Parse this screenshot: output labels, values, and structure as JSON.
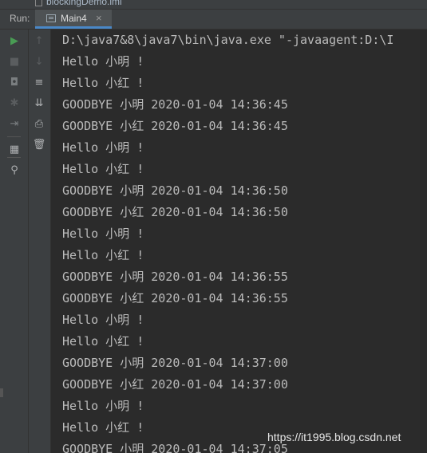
{
  "top_file": {
    "name": "blockingDemo.iml"
  },
  "run_panel": {
    "label": "Run:",
    "tab_label": "Main4",
    "tab_close": "×"
  },
  "toolbar_left": [
    {
      "icon": "run-icon",
      "glyph": "▶",
      "color": "#499c54"
    },
    {
      "icon": "stop-icon",
      "glyph": "■",
      "color": "#5a5d5f"
    },
    {
      "icon": "camera-icon",
      "glyph": "◘",
      "color": "#7a7e80"
    },
    {
      "icon": "bug-icon",
      "glyph": "✱",
      "color": "#5a5d5f"
    },
    {
      "icon": "login-icon",
      "glyph": "⇥",
      "color": "#7a7e80"
    },
    {
      "icon": "layout-icon",
      "glyph": "▦",
      "color": "#afb1b3"
    },
    {
      "icon": "pin-icon",
      "glyph": "⚲",
      "color": "#afb1b3"
    }
  ],
  "toolbar_right": [
    {
      "icon": "arrow-up-icon",
      "glyph": "↑",
      "color": "#5a5d5f"
    },
    {
      "icon": "arrow-down-icon",
      "glyph": "↓",
      "color": "#5a5d5f"
    },
    {
      "icon": "soft-wrap-icon",
      "glyph": "≡",
      "color": "#afb1b3"
    },
    {
      "icon": "scroll-to-end-icon",
      "glyph": "⇊",
      "color": "#afb1b3"
    },
    {
      "icon": "print-icon",
      "glyph": "⎙",
      "color": "#afb1b3"
    },
    {
      "icon": "trash-icon",
      "glyph": "🗑",
      "color": "#afb1b3"
    }
  ],
  "console_lines": [
    "D:\\java7&8\\java7\\bin\\java.exe \"-javaagent:D:\\I",
    "Hello 小明 !",
    "Hello 小红 !",
    "GOODBYE 小明 2020-01-04 14:36:45",
    "GOODBYE 小红 2020-01-04 14:36:45",
    "Hello 小明 !",
    "Hello 小红 !",
    "GOODBYE 小明 2020-01-04 14:36:50",
    "GOODBYE 小红 2020-01-04 14:36:50",
    "Hello 小明 !",
    "Hello 小红 !",
    "GOODBYE 小明 2020-01-04 14:36:55",
    "GOODBYE 小红 2020-01-04 14:36:55",
    "Hello 小明 !",
    "Hello 小红 !",
    "GOODBYE 小明 2020-01-04 14:37:00",
    "GOODBYE 小红 2020-01-04 14:37:00",
    "Hello 小明 !",
    "Hello 小红 !",
    "GOODBYE 小明 2020-01-04 14:37:05"
  ],
  "watermark": "https://it1995.blog.csdn.net",
  "colors": {
    "background": "#2b2b2b",
    "panel": "#3c3f41",
    "text": "#bbbbbb",
    "tab_underline": "#4a88c7"
  }
}
